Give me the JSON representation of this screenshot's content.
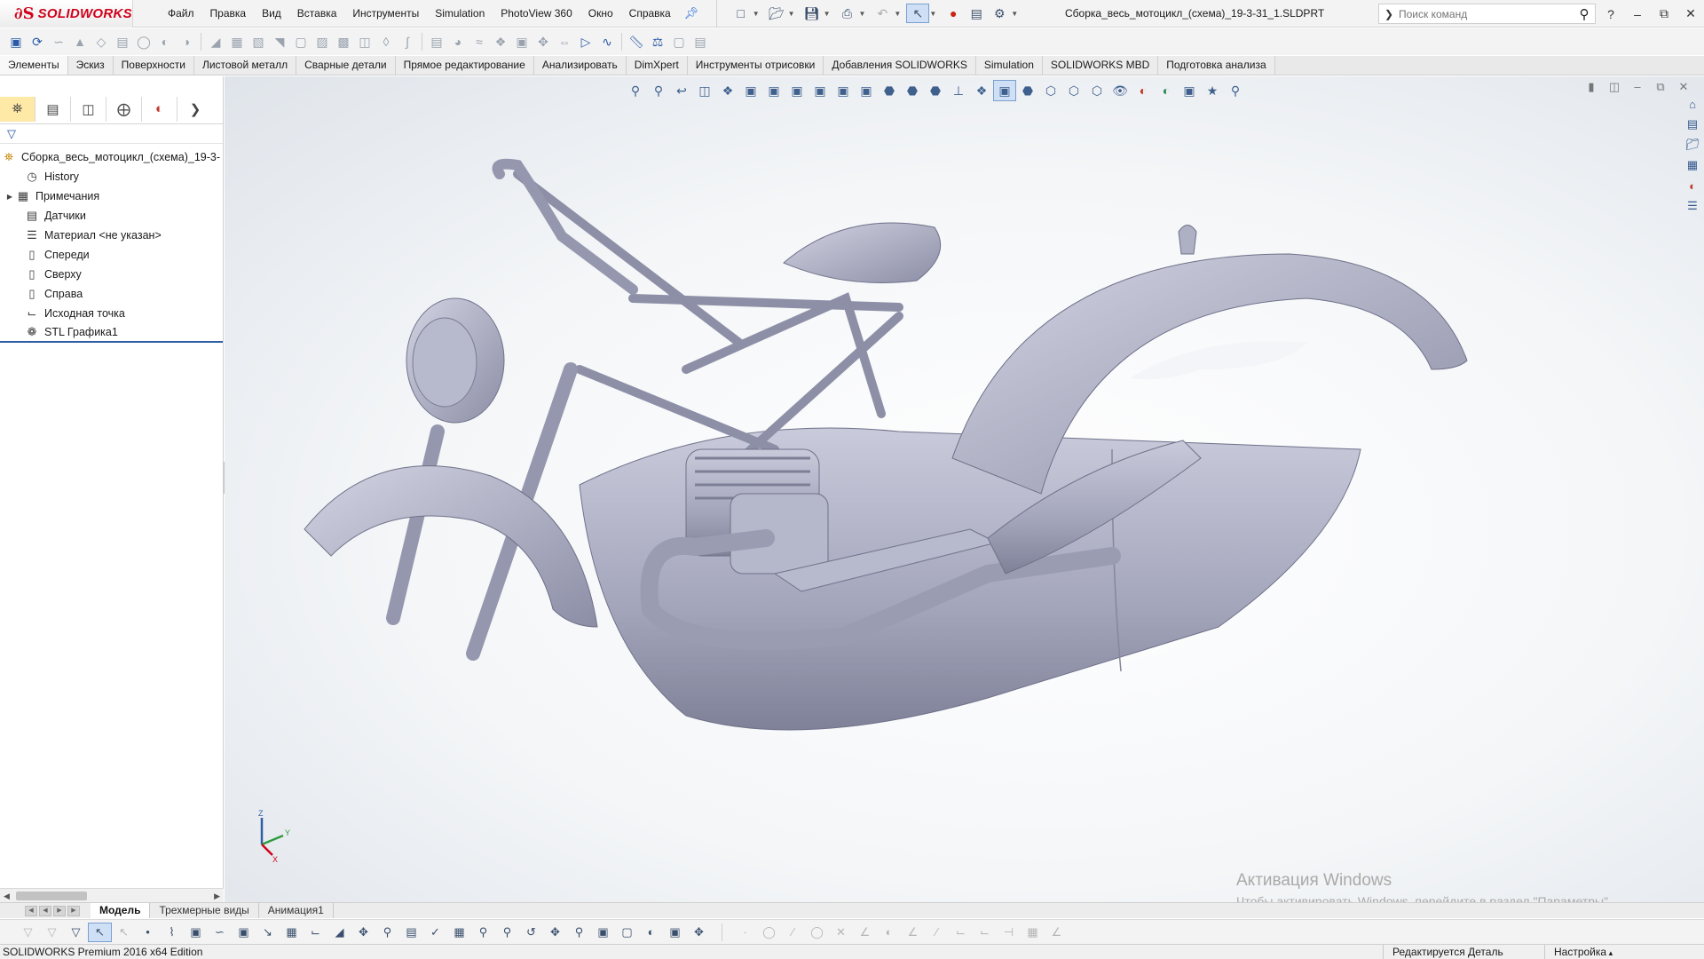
{
  "app": {
    "brand": "SOLIDWORKS",
    "ds_mark": "∂S",
    "doc_title": "Сборка_весь_мотоцикл_(схема)_19-3-31_1.SLDPRT"
  },
  "menu": [
    "Файл",
    "Правка",
    "Вид",
    "Вставка",
    "Инструменты",
    "Simulation",
    "PhotoView 360",
    "Окно",
    "Справка"
  ],
  "search": {
    "placeholder": "Поиск команд"
  },
  "tabs": [
    "Элементы",
    "Эскиз",
    "Поверхности",
    "Листовой металл",
    "Сварные детали",
    "Прямое редактирование",
    "Анализировать",
    "DimXpert",
    "Инструменты отрисовки",
    "Добавления SOLIDWORKS",
    "Simulation",
    "SOLIDWORKS MBD",
    "Подготовка анализа"
  ],
  "active_tab": "Элементы",
  "tree": {
    "root": "Сборка_весь_мотоцикл_(схема)_19-3-",
    "items": [
      {
        "label": "History",
        "icon": "history-icon"
      },
      {
        "label": "Примечания",
        "icon": "annotations-icon"
      },
      {
        "label": "Датчики",
        "icon": "sensor-icon"
      },
      {
        "label": "Материал <не указан>",
        "icon": "material-icon"
      },
      {
        "label": "Спереди",
        "icon": "plane-icon"
      },
      {
        "label": "Сверху",
        "icon": "plane-icon"
      },
      {
        "label": "Справа",
        "icon": "plane-icon"
      },
      {
        "label": "Исходная точка",
        "icon": "origin-icon"
      },
      {
        "label": "STL Графика1",
        "icon": "stl-icon"
      }
    ]
  },
  "bottom_tabs": [
    "Модель",
    "Трехмерные виды",
    "Анимация1"
  ],
  "active_bottom_tab": "Модель",
  "status": {
    "edition": "SOLIDWORKS Premium 2016 x64 Edition",
    "mode": "Редактируется Деталь",
    "settings": "Настройка"
  },
  "watermark": {
    "line1": "Активация Windows",
    "line2": "Чтобы активировать Windows, перейдите в раздел \"Параметры\"."
  },
  "triad": {
    "x": "X",
    "y": "Y",
    "z": "Z"
  },
  "colors": {
    "brand_red": "#d0021b",
    "model_gray": "#a9abc0",
    "selection_blue": "#2f5ea6"
  }
}
